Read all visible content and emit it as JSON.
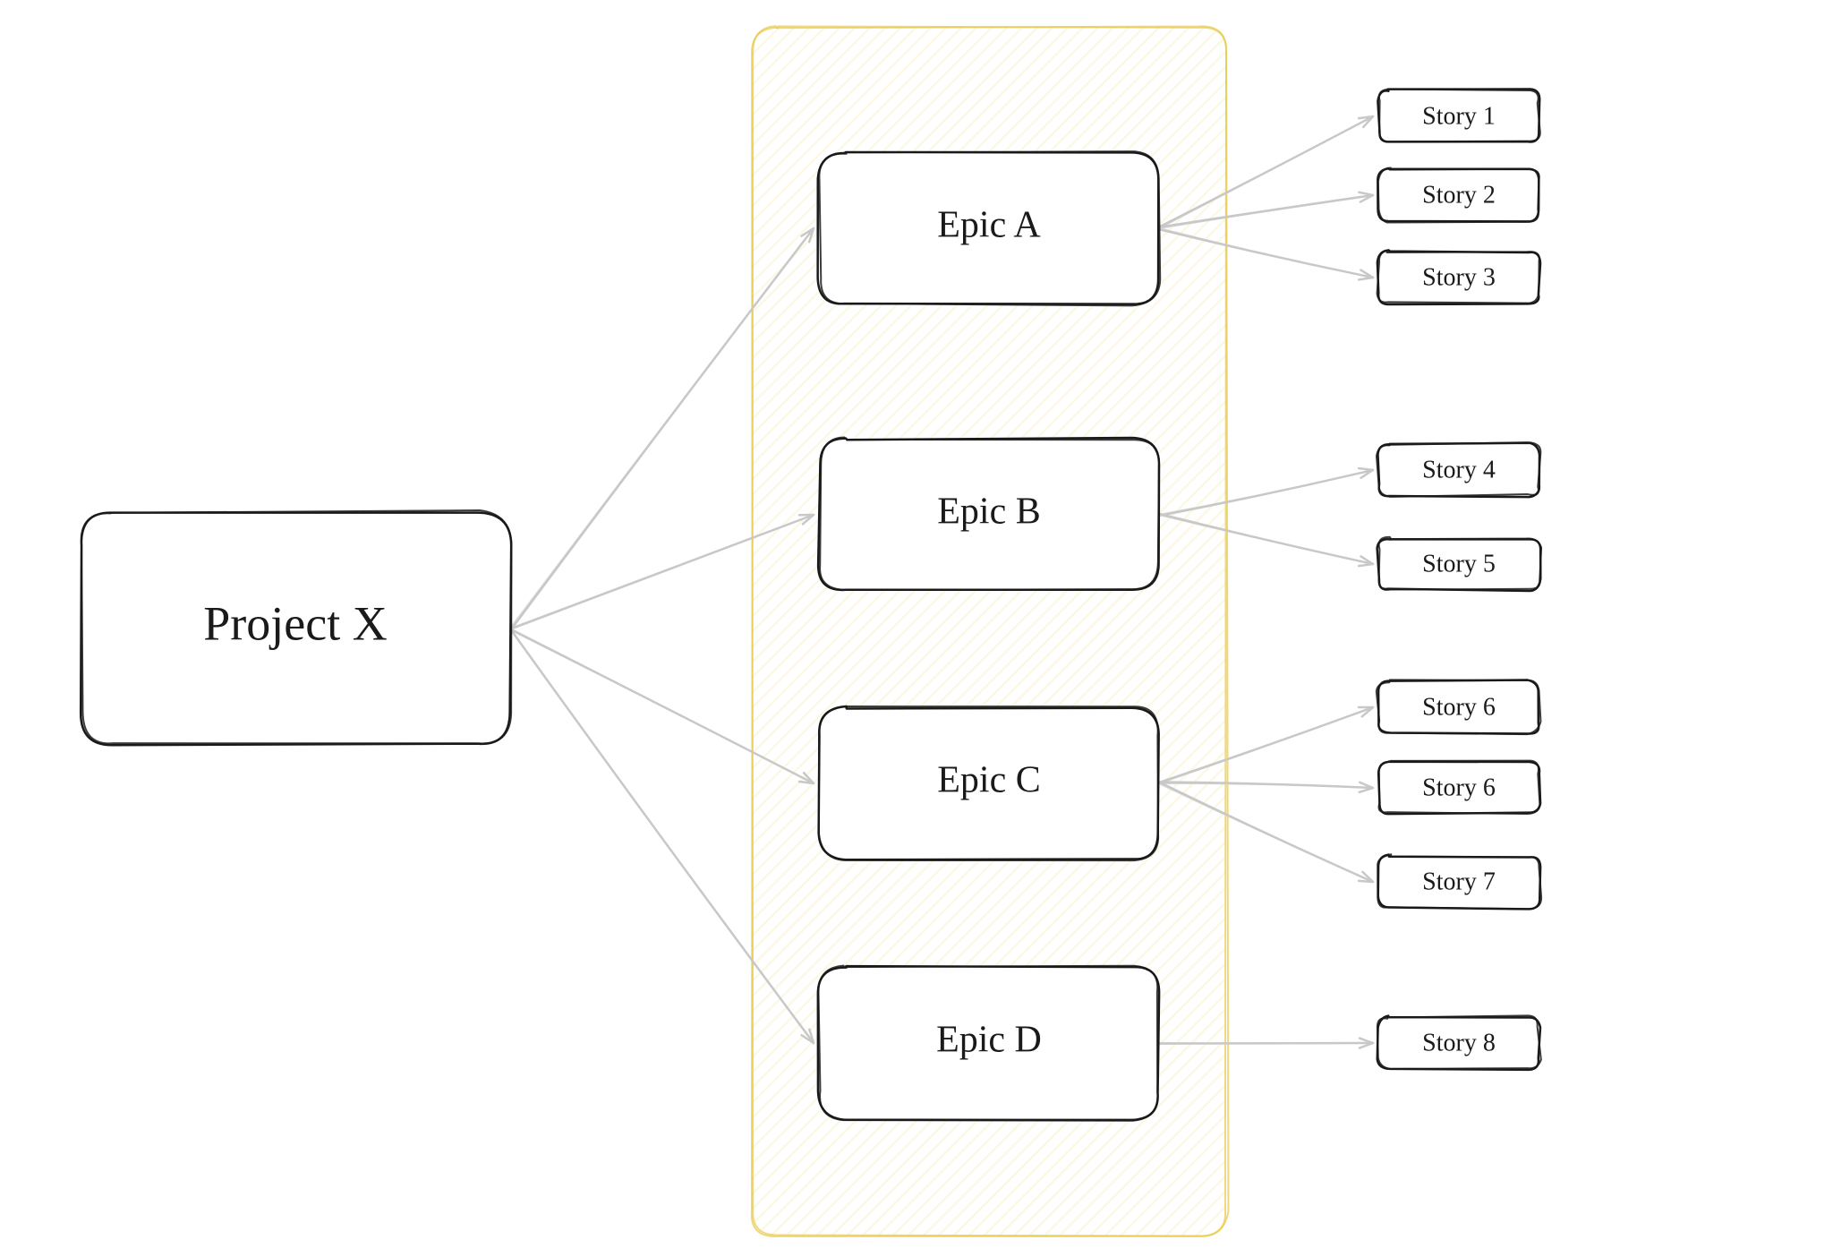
{
  "project": {
    "label": "Project X"
  },
  "epics": [
    {
      "id": "epic-a",
      "label": "Epic A",
      "stories": [
        "Story 1",
        "Story 2",
        "Story 3"
      ]
    },
    {
      "id": "epic-b",
      "label": "Epic B",
      "stories": [
        "Story 4",
        "Story 5"
      ]
    },
    {
      "id": "epic-c",
      "label": "Epic C",
      "stories": [
        "Story 6",
        "Story 6",
        "Story 7"
      ]
    },
    {
      "id": "epic-d",
      "label": "Epic D",
      "stories": [
        "Story 8"
      ]
    }
  ],
  "colors": {
    "stroke": "#1a1a1a",
    "arrow": "#c8c8c8",
    "group_stroke": "#e8c94a",
    "group_hatch": "#f2e6a3"
  }
}
